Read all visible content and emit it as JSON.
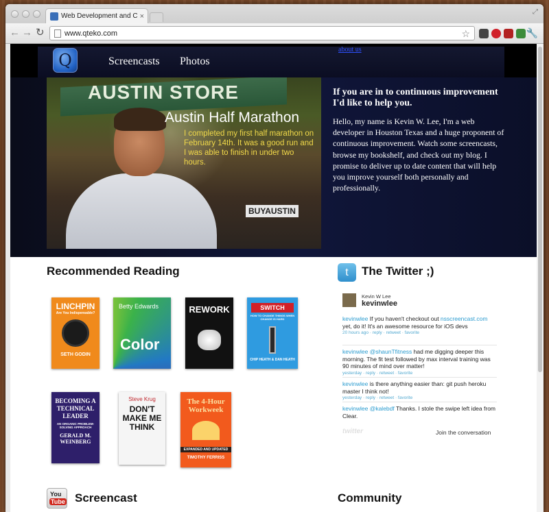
{
  "browser": {
    "tab_title": "Web Development and Conti",
    "tab_close": "×",
    "url": "www.qteko.com",
    "nav": {
      "back": "←",
      "forward": "→",
      "reload": "↻"
    },
    "star": "☆",
    "wrench": "🔧",
    "resize": "⤢",
    "extensions": [
      {
        "name": "reader-extension-icon",
        "color": "#444444"
      },
      {
        "name": "opera-extension-icon",
        "color": "#d0202a"
      },
      {
        "name": "car-extension-icon",
        "color": "#b22222"
      },
      {
        "name": "green-extension-icon",
        "color": "#3d8c3a"
      },
      {
        "name": "puzzle-extension-icon",
        "color": "#6a7c58"
      }
    ]
  },
  "site": {
    "logo_letter": "Q",
    "nav": {
      "screencasts": "Screencasts",
      "photos": "Photos",
      "about": "about us"
    },
    "hero": {
      "photo_title": "Austin Half Marathon",
      "photo_caption": "I completed my first half marathon on February 14th.  It was a good run and I was able to finish in under two hours.",
      "banner": "AUSTIN STORE",
      "buy_austin": "BUYAUSTIN",
      "heading": "If you are in to continuous improvement I'd like to help you.",
      "paragraph": "Hello, my name is Kevin W. Lee, I'm a web developer in Houston Texas and a huge proponent of continuous improvement. Watch some screencasts, browse my bookshelf, and check out my blog. I promise to deliver up to date content that will help you improve yourself both personally and professionally."
    },
    "reading": {
      "title": "Recommended Reading",
      "books": [
        {
          "title": "LINCHPIN",
          "subtitle": "Are You Indispensable?",
          "author": "SETH GODIN",
          "bg": "#f08a1c",
          "fg": "#ffffff"
        },
        {
          "title": "Color",
          "subtitle": "Betty Edwards",
          "author": "",
          "bg": "#2b2b2b",
          "fg": "#ffffff"
        },
        {
          "title": "REWORK",
          "subtitle": "",
          "author": "",
          "bg": "#111111",
          "fg": "#ffffff"
        },
        {
          "title": "SWITCH",
          "subtitle": "HOW TO CHANGE THINGS WHEN CHANGE IS HARD",
          "author": "CHIP HEATH & DAN HEATH",
          "bg": "#2f9be0",
          "fg": "#ffffff"
        },
        {
          "title": "BECOMING A TECHNICAL LEADER",
          "subtitle": "AN ORGANIC PROBLEM-SOLVING APPROACH",
          "author": "GERALD M. WEINBERG",
          "bg": "#2e1f6a",
          "fg": "#ffffff"
        },
        {
          "title": "DON'T MAKE ME THINK",
          "subtitle": "Steve Krug",
          "author": "",
          "bg": "#f5f5f5",
          "fg": "#111111"
        },
        {
          "title": "The 4-Hour Workweek",
          "subtitle": "EXPANDED AND UPDATED",
          "author": "TIMOTHY FERRISS",
          "bg": "#f25a1d",
          "fg": "#ffffff"
        }
      ]
    },
    "twitter": {
      "title": "The Twitter ;)",
      "logo": "t",
      "user_name": "Kevin W Lee",
      "user_handle": "kevinwlee",
      "tweets": [
        {
          "user": "kevinwlee",
          "text": "If you haven't checkout out ",
          "link": "nsscreencast.com",
          "text2": " yet, do it! It's an awesome resource for iOS devs",
          "meta": "20 hours ago · reply · retweet · favorite"
        },
        {
          "user": "kevinwlee",
          "text": "",
          "link": "@shaunTfitness",
          "text2": " had me digging deeper this morning. The fit test followed by max interval training was 90 minutes of mind over matter!",
          "meta": "yesterday · reply · retweet · favorite"
        },
        {
          "user": "kevinwlee",
          "text": "is there anything easier than: git push heroku master I think not!",
          "link": "",
          "text2": "",
          "meta": "yesterday · reply · retweet · favorite"
        },
        {
          "user": "kevinwlee",
          "text": "",
          "link": "@kalebdf",
          "text2": " Thanks. I stole the swipe left idea from Clear.",
          "meta": ""
        }
      ],
      "join": "Join the conversation",
      "watermark": "twitter"
    },
    "screencast": {
      "title": "Screencast",
      "yt_you": "You",
      "yt_tube": "Tube"
    },
    "community": {
      "title": "Community"
    }
  }
}
